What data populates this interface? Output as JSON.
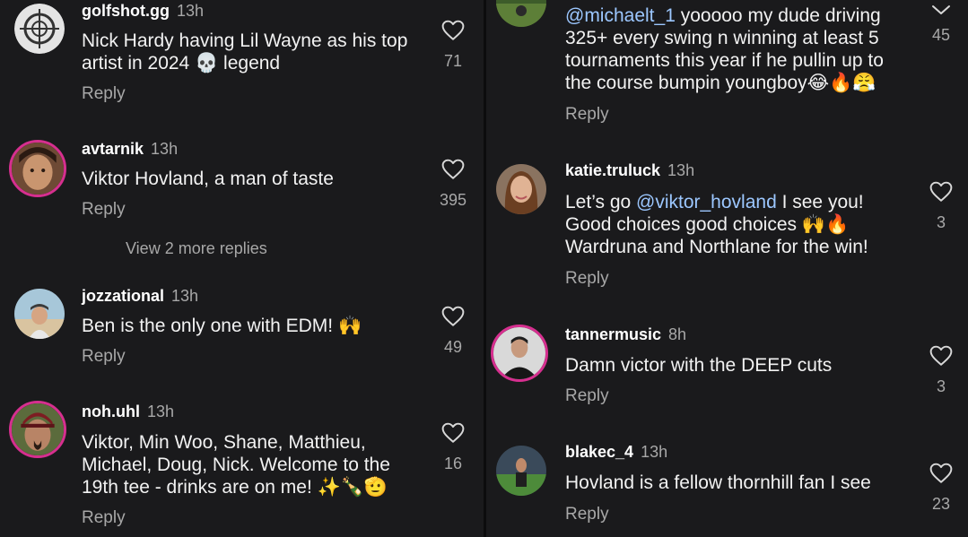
{
  "left": [
    {
      "user": "golfshot.gg",
      "time": "13h",
      "text": "Nick Hardy having Lil Wayne as his top\nartist in 2024 💀 legend",
      "reply": "Reply",
      "likes": "71",
      "avatar": "crosshair-avatar"
    },
    {
      "user": "avtarnik",
      "time": "13h",
      "text": "Viktor Hovland, a man of taste",
      "reply": "Reply",
      "likes": "395",
      "view_more": "View 2 more replies",
      "avatar": "person-avatar"
    },
    {
      "user": "jozzational",
      "time": "13h",
      "text": "Ben is the only one with EDM! 🙌",
      "reply": "Reply",
      "likes": "49",
      "avatar": "beach-avatar"
    },
    {
      "user": "noh.uhl",
      "time": "13h",
      "text": "Viktor, Min Woo, Shane, Matthieu,\nMichael, Doug, Nick. Welcome to the\n19th tee - drinks are on me! ✨🍾🫡",
      "reply": "Reply",
      "likes": "16",
      "avatar": "cap-avatar"
    }
  ],
  "right": [
    {
      "mention": "@michaelt_1",
      "text": " yooooo my dude driving\n325+ every swing n winning at least 5\ntournaments this year if he pullin up to\nthe course bumpin youngboy😂🔥😤",
      "reply": "Reply",
      "likes": "45"
    },
    {
      "user": "katie.truluck",
      "time": "13h",
      "pre": "Let’s go ",
      "mention": "@viktor_hovland",
      "post": " I see you!\nGood choices good choices 🙌🔥\nWardruna and Northlane for the win!",
      "reply": "Reply",
      "likes": "3"
    },
    {
      "user": "tannermusic",
      "time": "8h",
      "text": "Damn victor with the DEEP cuts",
      "reply": "Reply",
      "likes": "3"
    },
    {
      "user": "blakec_4",
      "time": "13h",
      "text": "Hovland is a fellow thornhill fan I see",
      "reply": "Reply",
      "likes": "23"
    }
  ],
  "colors": {
    "background": "#1a1a1c",
    "mention": "#9cc7ff",
    "ring": "#d62f8f",
    "muted": "#a8a8a8"
  }
}
